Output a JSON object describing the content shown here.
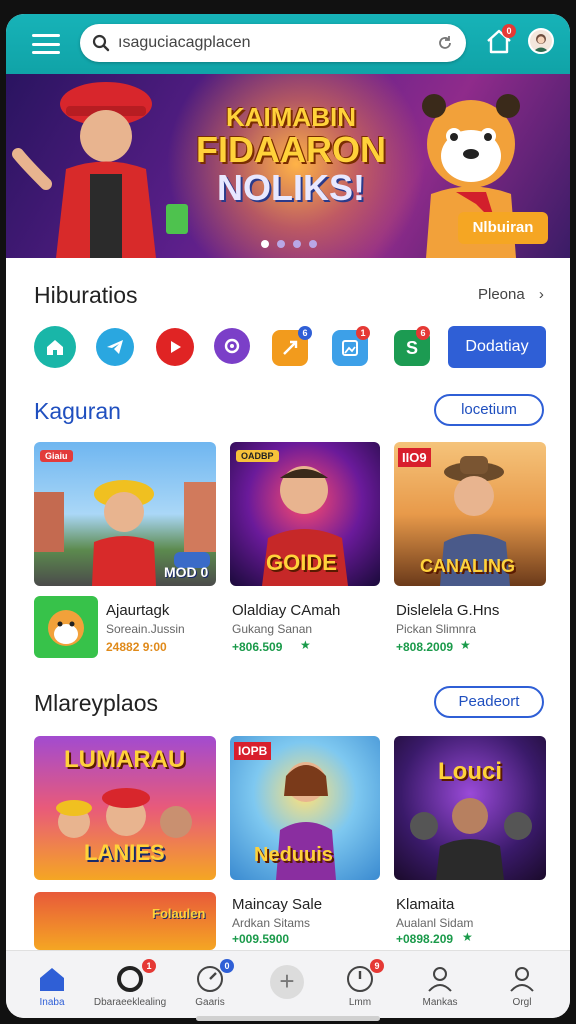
{
  "search": {
    "value": "ısaguciacagplacen"
  },
  "notification_count": "0",
  "banner": {
    "title_line1": "KAIMABIN",
    "title_line2": "FIDAARON",
    "title_line3": "NOLIKS!",
    "cta_label": "Nlbuiran",
    "pager_count": 4,
    "active_page": 1
  },
  "section1": {
    "title": "Hiburatios",
    "see_all": "Pleona",
    "apps": [
      {
        "name": "home-app-icon",
        "color": "#19b6a8",
        "badge": ""
      },
      {
        "name": "telegram-app-icon",
        "color": "#2aa7e0",
        "badge": ""
      },
      {
        "name": "youtube-app-icon",
        "color": "#e02424",
        "badge": ""
      },
      {
        "name": "chat-app-icon",
        "color": "#7b3fc8",
        "badge": ""
      },
      {
        "name": "game-app-icon",
        "color": "#f29b1d",
        "badge": "6"
      },
      {
        "name": "photo-app-icon",
        "color": "#3da0e8",
        "badge": "1"
      },
      {
        "name": "sheets-app-icon",
        "color": "#1c9b52",
        "badge": "6"
      }
    ],
    "action_button": "Dodatiay"
  },
  "section2": {
    "title": "Kaguran",
    "action_button": "locetium",
    "cards": [
      {
        "label": "MOD 0",
        "tag": "Giaiu"
      },
      {
        "label": "GOIDE",
        "tag": "OADBP"
      },
      {
        "label": "CANALING",
        "tag": "IIO9"
      }
    ],
    "games": [
      {
        "name": "Ajaurtagk",
        "sub": "Soreain.Jussin",
        "price": "24882 9:00"
      },
      {
        "name": "Olaldiay CAmah",
        "sub": "Gukang Sanan",
        "price": "+806.509"
      },
      {
        "name": "Dislelela G.Hns",
        "sub": "Pickan Slimnra",
        "price": "+808.2009"
      }
    ]
  },
  "section3": {
    "title": "Mlareyplaos",
    "action_button": "Peadeort",
    "cards": [
      {
        "label1": "LUMARAU",
        "label2": "LANIES"
      },
      {
        "label1": "IOPB",
        "label2": "Neduuis"
      },
      {
        "label1": "Louci",
        "label2": ""
      }
    ],
    "games": [
      {
        "name": "Maincay Sale",
        "sub": "Ardkan Sitams",
        "price": "+009.5900"
      },
      {
        "name": "Klamaita",
        "sub": "Aualanl Sidam",
        "price": "+0898.209"
      }
    ],
    "partial_card_label": "Folaulen"
  },
  "bottom_nav": [
    {
      "label": "Inaba",
      "icon": "home-icon",
      "active": true,
      "badge": ""
    },
    {
      "label": "Dbaraeeklealing",
      "icon": "circle-icon",
      "active": false,
      "badge": "1"
    },
    {
      "label": "Gaaris",
      "icon": "gauge-icon",
      "active": false,
      "badge": "0"
    },
    {
      "label": "",
      "icon": "add-icon",
      "active": false,
      "badge": ""
    },
    {
      "label": "Lmm",
      "icon": "timer-icon",
      "active": false,
      "badge": "9"
    },
    {
      "label": "Mankas",
      "icon": "person-icon",
      "active": false,
      "badge": ""
    },
    {
      "label": "Orgl",
      "icon": "profile-icon",
      "active": false,
      "badge": ""
    }
  ],
  "colors": {
    "accent": "#17b3b8",
    "primary_blue": "#2f5fd6",
    "price_green": "#1a9a4a"
  }
}
